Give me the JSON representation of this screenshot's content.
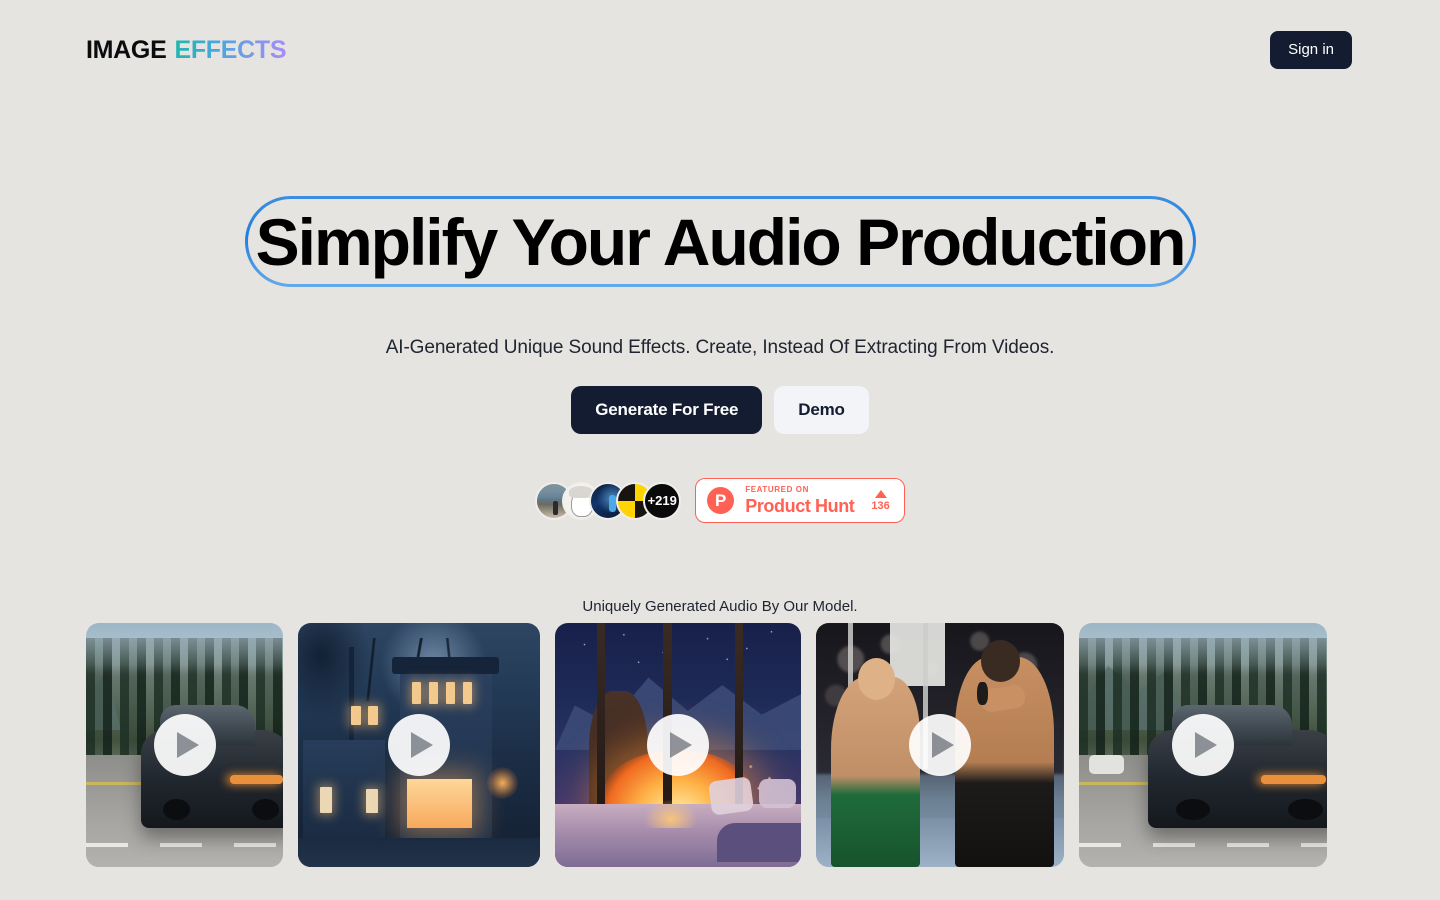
{
  "header": {
    "logo_word_1": "IMAGE",
    "logo_word_2": "EFFECTS",
    "signin_label": "Sign in"
  },
  "hero": {
    "headline": "Simplify Your Audio Production",
    "subtitle": "AI-Generated Unique Sound Effects. Create, Instead Of Extracting From Videos.",
    "primary_cta": "Generate For Free",
    "secondary_cta": "Demo"
  },
  "social_proof": {
    "avatar_count_label": "+219",
    "avatars": [
      {
        "alt": "user-photo-street"
      },
      {
        "alt": "user-sketch-portrait"
      },
      {
        "alt": "user-blue-tech-art"
      },
      {
        "alt": "user-yellow-black-checker"
      }
    ],
    "product_hunt": {
      "logo_letter": "P",
      "featured_label": "FEATURED ON",
      "name": "Product Hunt",
      "upvotes": "136"
    }
  },
  "gallery": {
    "title": "Uniquely Generated Audio By Our Model.",
    "cards": [
      {
        "alt": "black sports car driving on forest highway"
      },
      {
        "alt": "anime night street with lit house windows"
      },
      {
        "alt": "cozy cabin fireplace with snowy mountain view"
      },
      {
        "alt": "MMA fighters exchanging punches in the cage"
      },
      {
        "alt": "black sports car on mountain highway wide shot"
      }
    ]
  },
  "colors": {
    "background": "#e6e4e0",
    "dark_button": "#131c31",
    "light_button": "#f2f4f8",
    "headline_border": "#2b82e0",
    "logo_gradient_start": "#1fb6ad",
    "logo_gradient_end": "#a78bfa",
    "product_hunt": "#ff6154"
  }
}
